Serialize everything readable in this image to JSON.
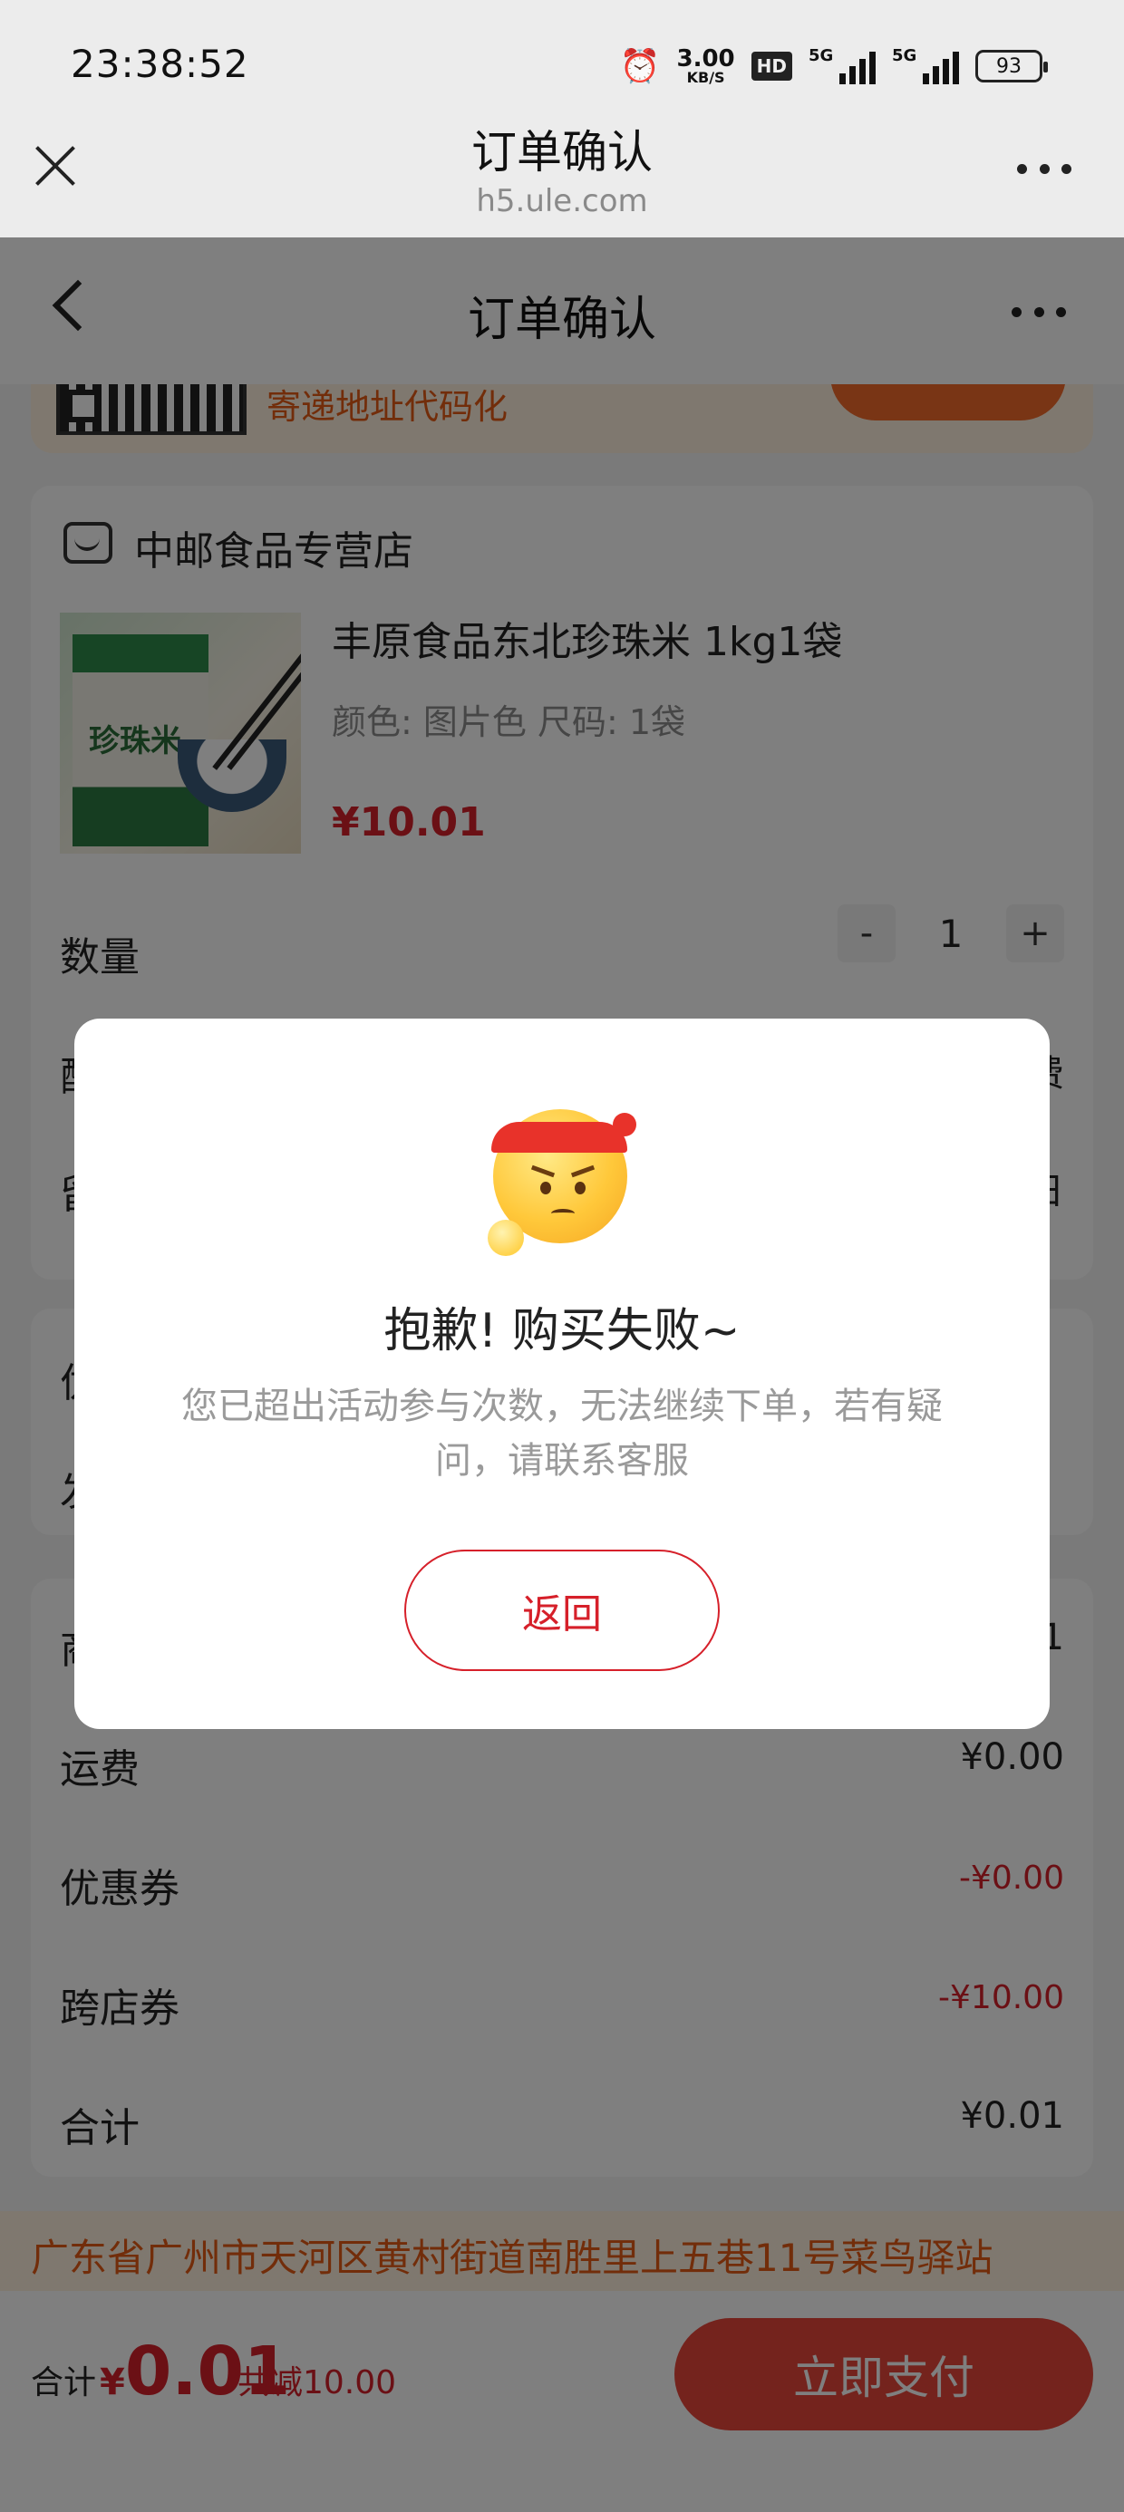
{
  "status_bar": {
    "time": "23:38:52",
    "net_speed_value": "3.00",
    "net_speed_unit": "KB/S",
    "hd_label": "HD",
    "signal1_label": "5G",
    "signal2_label": "5G",
    "battery": "93"
  },
  "browser": {
    "title": "订单确认",
    "url": "h5.ule.com"
  },
  "page_nav": {
    "title": "订单确认"
  },
  "banner": {
    "text": "寄递地址代码化"
  },
  "shop": {
    "name": "中邮食品专营店"
  },
  "product": {
    "image_text": "珍珠米",
    "title": "丰原食品东北珍珠米 1kg1袋",
    "spec": "颜色: 图片色 尺码: 1袋",
    "price": "¥10.01"
  },
  "quantity": {
    "label": "数量",
    "minus": "-",
    "value": "1",
    "plus": "+"
  },
  "hidden_rows": {
    "row1_label": "配",
    "row1_value": "费",
    "row2_label": "留",
    "row2_value": "日",
    "row3_label": "优",
    "row4_label": "发",
    "row5_label": "商",
    "row5_value": "1"
  },
  "summary": {
    "shipping_label": "运费",
    "shipping_value": "¥0.00",
    "coupon_label": "优惠券",
    "coupon_value": "-¥0.00",
    "cross_coupon_label": "跨店券",
    "cross_coupon_value": "-¥10.00",
    "total_label": "合计",
    "total_value": "¥0.01"
  },
  "address": {
    "text": "广东省广州市天河区黄村街道南胜里上五巷11号菜鸟驿站"
  },
  "bottom_bar": {
    "total_label": "合计",
    "currency": "¥",
    "amount": "0.01",
    "discount": "共减10.00",
    "pay_button": "立即支付"
  },
  "modal": {
    "title": "抱歉! 购买失败~",
    "message": "您已超出活动参与次数，无法继续下单，若有疑问，请联系客服",
    "button": "返回"
  },
  "colors": {
    "accent_red": "#d6202a",
    "orange": "#e55a14",
    "pay_button": "#e8463a"
  }
}
